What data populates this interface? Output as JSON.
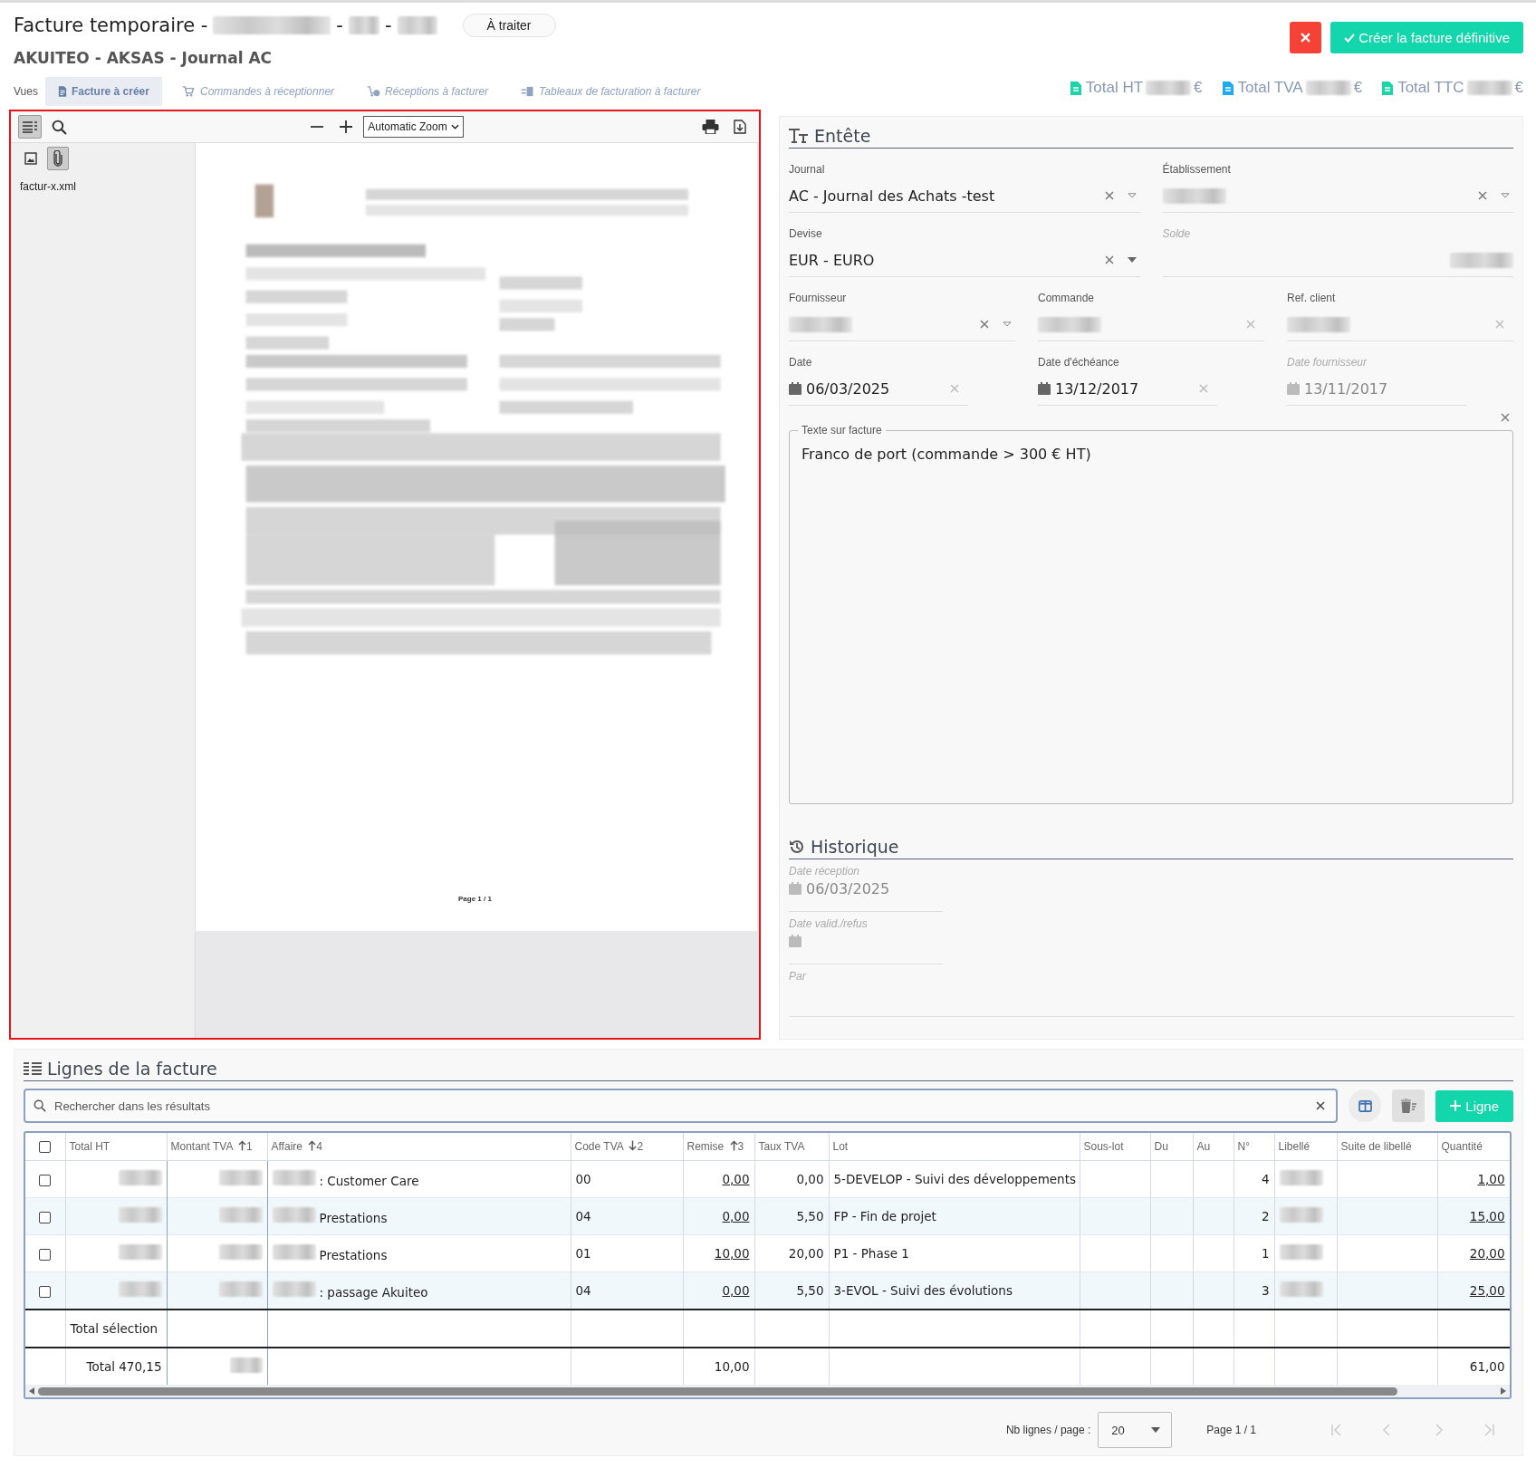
{
  "header": {
    "title": "Facture temporaire -",
    "separators": [
      "-",
      "-"
    ],
    "status": "À traiter",
    "subtitle": "AKUITEO - AKSAS - Journal AC"
  },
  "actions": {
    "create": "Créer la facture définitive"
  },
  "views": {
    "label": "Vues",
    "items": [
      {
        "label": "Facture à créer",
        "kind": "invoice",
        "selected": true
      },
      {
        "label": "Commandes à réceptionner",
        "kind": "cart",
        "selected": false
      },
      {
        "label": "Réceptions à facturer",
        "kind": "delivery",
        "selected": false
      },
      {
        "label": "Tableaux de facturation à facturer",
        "kind": "table",
        "selected": false
      }
    ]
  },
  "totals": [
    {
      "label": "Total HT",
      "currency": "€",
      "color": "#1dd3a7"
    },
    {
      "label": "Total TVA",
      "currency": "€",
      "color": "#1eaaf1"
    },
    {
      "label": "Total TTC",
      "currency": "€",
      "color": "#1dd3a7"
    }
  ],
  "viewer": {
    "zoom": "Automatic Zoom",
    "attachment": "factur-x.xml",
    "sidebar_open": true,
    "page_footer": "Page 1 / 1"
  },
  "entete": {
    "title": "Entête",
    "rows": [
      [
        {
          "label": "Journal",
          "kind": "select",
          "value": "AC - Journal des Achats -test"
        },
        {
          "label": "Établissement",
          "kind": "select",
          "redacted": true
        }
      ],
      [
        {
          "label": "Devise",
          "kind": "dropdown",
          "value": "EUR - EURO"
        },
        {
          "label": "Solde",
          "kind": "readonly",
          "redacted": true,
          "disabled": true
        }
      ],
      [
        {
          "label": "Fournisseur",
          "kind": "select",
          "redacted": true
        },
        {
          "label": "Commande",
          "kind": "input",
          "redacted": true
        },
        {
          "label": "Ref. client",
          "kind": "input",
          "redacted": true
        }
      ],
      [
        {
          "label": "Date",
          "kind": "date",
          "value": "06/03/2025"
        },
        {
          "label": "Date d'échéance",
          "kind": "date",
          "value": "13/12/2017"
        },
        {
          "label": "Date fournisseur",
          "kind": "date",
          "value": "13/11/2017",
          "disabled": true
        }
      ]
    ],
    "note": {
      "label": "Texte sur facture",
      "value": "Franco de port (commande > 300 € HT)"
    }
  },
  "historique": {
    "title": "Historique",
    "fields": [
      {
        "label": "Date réception",
        "kind": "date",
        "value": "06/03/2025",
        "disabled": true
      },
      {
        "label": "Date valid./refus",
        "kind": "date",
        "disabled": true
      },
      {
        "label": "Par",
        "kind": "input",
        "disabled": true
      }
    ]
  },
  "lines": {
    "title": "Lignes de la facture",
    "search": {
      "placeholder": "Rechercher dans les résultats"
    },
    "add": "Ligne",
    "columns": [
      {
        "kind": "check",
        "checked": false
      },
      {
        "label": "Total HT",
        "kind": "number"
      },
      {
        "label": "Montant TVA",
        "kind": "number",
        "sort": {
          "descending": false,
          "order": "1"
        }
      },
      {
        "label": "Affaire",
        "kind": "text",
        "sort": {
          "descending": false,
          "order": "4"
        }
      },
      {
        "label": "Code TVA",
        "kind": "text",
        "sort": {
          "descending": true,
          "order": "2"
        }
      },
      {
        "label": "Remise",
        "kind": "link",
        "sort": {
          "descending": false,
          "order": "3"
        }
      },
      {
        "label": "Taux TVA",
        "kind": "number"
      },
      {
        "label": "Lot",
        "kind": "text"
      },
      {
        "label": "Sous-lot",
        "kind": "text"
      },
      {
        "label": "Du",
        "kind": "text"
      },
      {
        "label": "Au",
        "kind": "text"
      },
      {
        "label": "N°",
        "kind": "number"
      },
      {
        "label": "Libellé",
        "kind": "text"
      },
      {
        "label": "Suite de libellé",
        "kind": "text"
      },
      {
        "label": "Quantité",
        "kind": "link"
      }
    ],
    "rows": [
      {
        "checked": false,
        "cells": [
          null,
          {
            "redacted": true
          },
          {
            "redacted": true
          },
          {
            "redacted": true,
            "text": ": Customer Care"
          },
          "00",
          "0,00",
          "0,00",
          "5-DEVELOP - Suivi des développements",
          null,
          null,
          null,
          "4",
          {
            "redacted": true
          },
          null,
          "1,00"
        ]
      },
      {
        "checked": false,
        "cells": [
          null,
          {
            "redacted": true
          },
          {
            "redacted": true
          },
          {
            "redacted": true,
            "text": "Prestations"
          },
          "04",
          "0,00",
          "5,50",
          "FP - Fin de projet",
          null,
          null,
          null,
          "2",
          {
            "redacted": true
          },
          null,
          "15,00"
        ]
      },
      {
        "checked": false,
        "cells": [
          null,
          {
            "redacted": true
          },
          {
            "redacted": true
          },
          {
            "redacted": true,
            "text": "Prestations"
          },
          "01",
          "10,00",
          "20,00",
          "P1 - Phase 1",
          null,
          null,
          null,
          "1",
          {
            "redacted": true
          },
          null,
          "20,00"
        ]
      },
      {
        "checked": false,
        "cells": [
          null,
          {
            "redacted": true
          },
          {
            "redacted": true
          },
          {
            "redacted": true,
            "text": ": passage Akuiteo"
          },
          "04",
          "0,00",
          "5,50",
          "3-EVOL - Suivi des évolutions",
          null,
          null,
          null,
          "3",
          {
            "redacted": true
          },
          null,
          "25,00"
        ]
      }
    ],
    "footer": [
      {
        "cells": [
          null,
          "Total sélection",
          null,
          null,
          null,
          null,
          null,
          null,
          null,
          null,
          null,
          null,
          null,
          null,
          null
        ]
      },
      {
        "cells": [
          null,
          "Total 470,15",
          {
            "redacted": true
          },
          null,
          null,
          "10,00",
          null,
          null,
          null,
          null,
          null,
          null,
          null,
          null,
          "61,00"
        ]
      }
    ],
    "pagination": {
      "per_page_label": "Nb lignes / page :",
      "per_page": "20",
      "page": "Page 1 / 1"
    }
  }
}
